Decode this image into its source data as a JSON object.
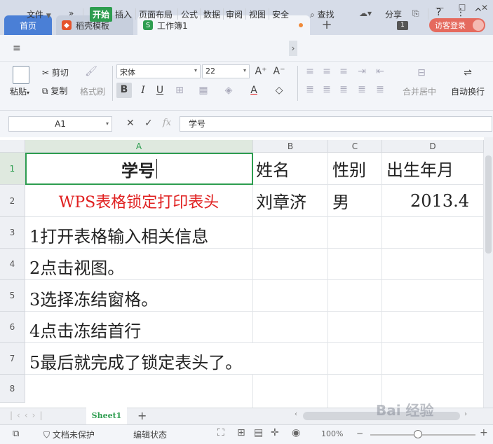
{
  "tabs": {
    "home": "首页",
    "docer": "稻壳模板",
    "workbook": "工作簿1",
    "plus": "+",
    "window_count": "1",
    "login": "访客登录"
  },
  "menubar": {
    "file": "文件",
    "more": "»",
    "items": [
      "开始",
      "插入",
      "页面布局",
      "公式",
      "数据",
      "审阅",
      "视图",
      "安全"
    ],
    "search": "查找",
    "share": "分享",
    "help": "?",
    "kebab": "⋮",
    "collapse": "^"
  },
  "ribbon": {
    "paste": "粘贴",
    "cut": "剪切",
    "copy": "复制",
    "format_painter": "格式刷",
    "font_name": "宋体",
    "font_size": "22",
    "bold": "B",
    "italic": "I",
    "underline": "U",
    "merge_center": "合并居中",
    "wrap_text": "自动换行"
  },
  "formula_bar": {
    "cell_ref": "A1",
    "fx": "fx",
    "value": "学号"
  },
  "grid": {
    "columns": [
      "A",
      "B",
      "C",
      "D"
    ],
    "rows": [
      "1",
      "2",
      "3",
      "4",
      "5",
      "6",
      "7",
      "8"
    ],
    "cells": {
      "A1": "学号",
      "B1": "姓名",
      "C1": "性别",
      "D1": "出生年月",
      "A2": "WPS表格锁定打印表头",
      "B2": "刘章济",
      "C2": "男",
      "D2": "2013.4",
      "A3": "1打开表格输入相关信息",
      "A4": "2点击视图。",
      "A5": "3选择冻结窗格。",
      "A6": "4点击冻结首行",
      "A7": "5最后就完成了锁定表头了。"
    }
  },
  "sheets": {
    "active": "Sheet1",
    "add": "+"
  },
  "status": {
    "protect": "文档未保护",
    "edit_state": "编辑状态",
    "zoom": "100%"
  },
  "watermark": "Bai 经验",
  "colors": {
    "accent_green": "#2d9d4f",
    "tab_blue": "#4a7fd6",
    "login_red": "#e56a5e",
    "red_text": "#e02020"
  }
}
